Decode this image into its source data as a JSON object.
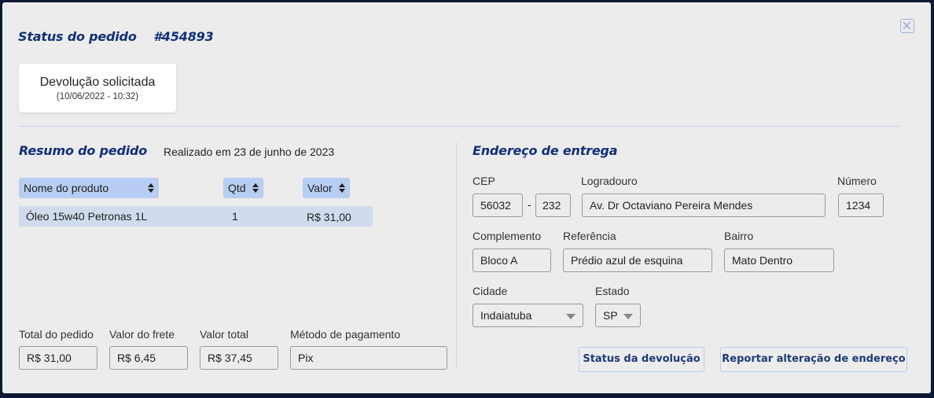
{
  "modal": {
    "title": "Status do pedido",
    "order_number": "#454893"
  },
  "status_card": {
    "status": "Devolução solicitada",
    "datetime": "(10/06/2022 - 10:32)"
  },
  "summary": {
    "title": "Resumo do pedido",
    "placed_on": "Realizado em 23 de junho de 2023",
    "columns": [
      "Nome do produto",
      "Qtd",
      "Valor"
    ],
    "rows": [
      {
        "product": "Óleo 15w40 Petronas 1L",
        "qty": "1",
        "value": "R$ 31,00"
      }
    ],
    "totals": {
      "order_total_label": "Total do pedido",
      "order_total": "R$ 31,00",
      "shipping_label": "Valor do frete",
      "shipping": "R$ 6,45",
      "grand_total_label": "Valor total",
      "grand_total": "R$ 37,45",
      "payment_label": "Método de pagamento",
      "payment": "Pix"
    }
  },
  "address": {
    "title": "Endereço de entrega",
    "cep_label": "CEP",
    "cep_part1": "56032",
    "cep_separator": "-",
    "cep_part2": "232",
    "street_label": "Logradouro",
    "street": "Av. Dr Octaviano Pereira Mendes",
    "number_label": "Número",
    "number": "1234",
    "complement_label": "Complemento",
    "complement": "Bloco A",
    "reference_label": "Referência",
    "reference": "Prédio azul de esquina",
    "district_label": "Bairro",
    "district": "Mato Dentro",
    "city_label": "Cidade",
    "city": "Indaiatuba",
    "state_label": "Estado",
    "state": "SP"
  },
  "buttons": {
    "return_status": "Status da devolução",
    "report_address": "Reportar alteração de endereço"
  },
  "colors": {
    "heading": "#12307a",
    "header_cell": "#b7cdf1",
    "row": "#d0dbee",
    "divider": "#c6d3ea",
    "button_text": "#1d3a7a"
  },
  "icons": {
    "close": "close-icon",
    "sort": "sort-icon",
    "dropdown": "caret-down-icon"
  }
}
